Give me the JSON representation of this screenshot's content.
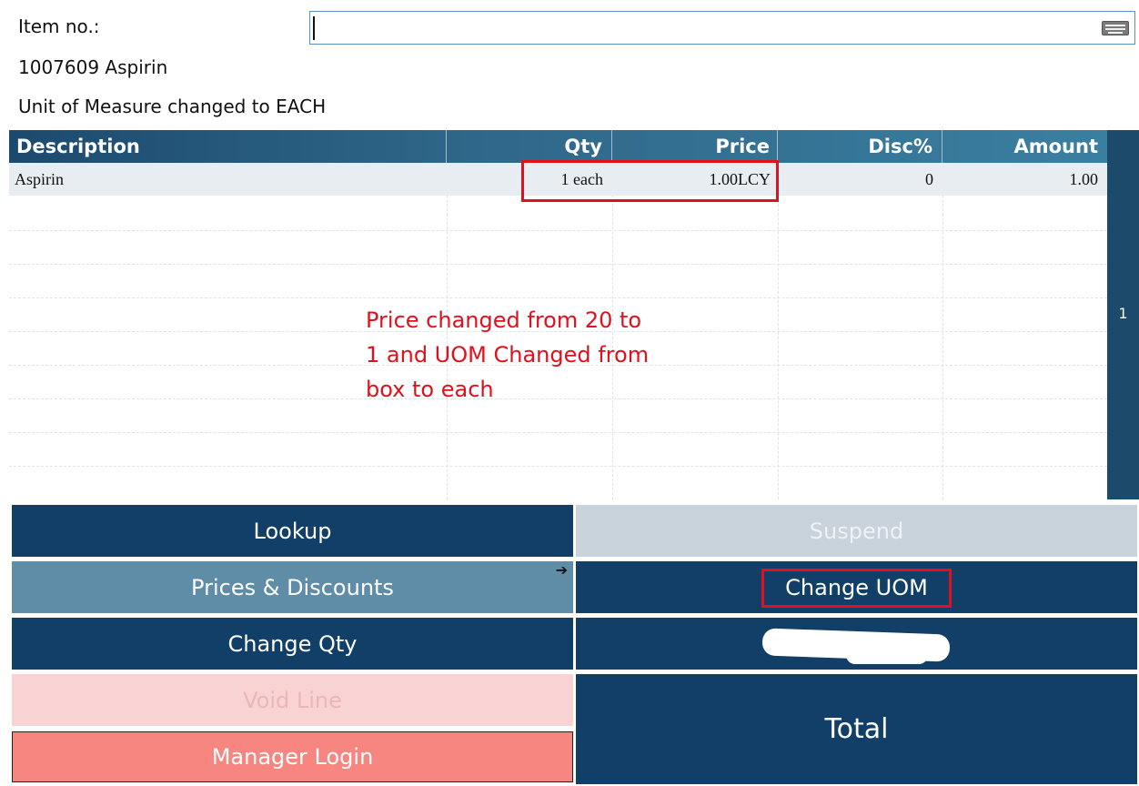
{
  "header": {
    "item_no_label": "Item no.:",
    "item_no_value": "",
    "item_line": "1007609 Aspirin",
    "status_message": "Unit of Measure changed to EACH"
  },
  "grid": {
    "columns": [
      "Description",
      "Qty",
      "Price",
      "Disc%",
      "Amount"
    ],
    "rows": [
      {
        "description": "Aspirin",
        "qty": "1 each",
        "price": "1.00LCY",
        "disc": "0",
        "amount": "1.00"
      }
    ],
    "scroll_indicator": "1"
  },
  "annotation": {
    "text_line1": "Price changed from 20 to",
    "text_line2": "1 and UOM Changed from",
    "text_line3": "box to each",
    "color": "#e0101c"
  },
  "buttons": {
    "lookup": "Lookup",
    "suspend": "Suspend",
    "prices_discounts": "Prices & Discounts",
    "change_uom": "Change UOM",
    "change_qty": "Change Qty",
    "void_line": "Void Line",
    "manager_login": "Manager Login",
    "total": "Total"
  },
  "colors": {
    "primary_button": "#113f67",
    "header_gradient_start": "#1c4a6e",
    "header_gradient_end": "#3b7fa0",
    "alert_button": "#f78580",
    "highlight": "#e0101c"
  }
}
